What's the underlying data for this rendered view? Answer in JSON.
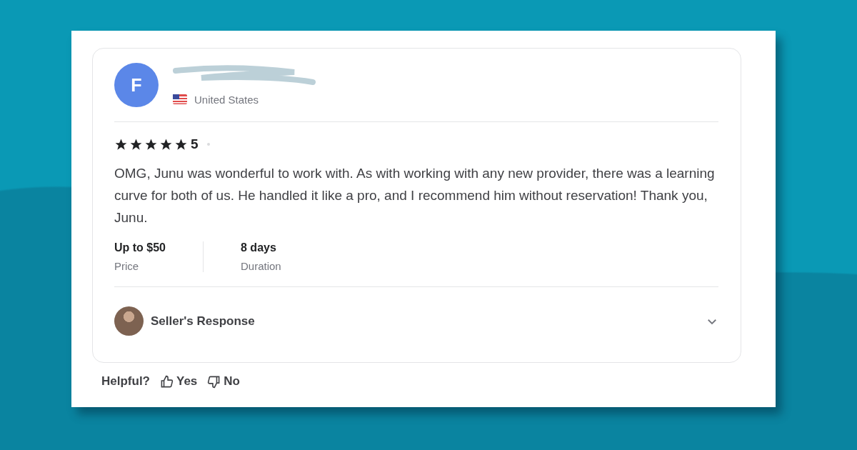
{
  "review": {
    "avatar_letter": "F",
    "country": "United States",
    "stars": 5,
    "rating": "5",
    "text": "OMG, Junu was wonderful to work with. As with working with any new provider, there was a learning curve for both of us. He handled it like a pro, and I recommend him without reservation! Thank you, Junu.",
    "stats": [
      {
        "value": "Up to $50",
        "label": "Price"
      },
      {
        "value": "8 days",
        "label": "Duration"
      }
    ],
    "seller_response": {
      "title": "Seller's Response",
      "expanded": false
    }
  },
  "helpful": {
    "label": "Helpful?",
    "yes": "Yes",
    "no": "No"
  }
}
